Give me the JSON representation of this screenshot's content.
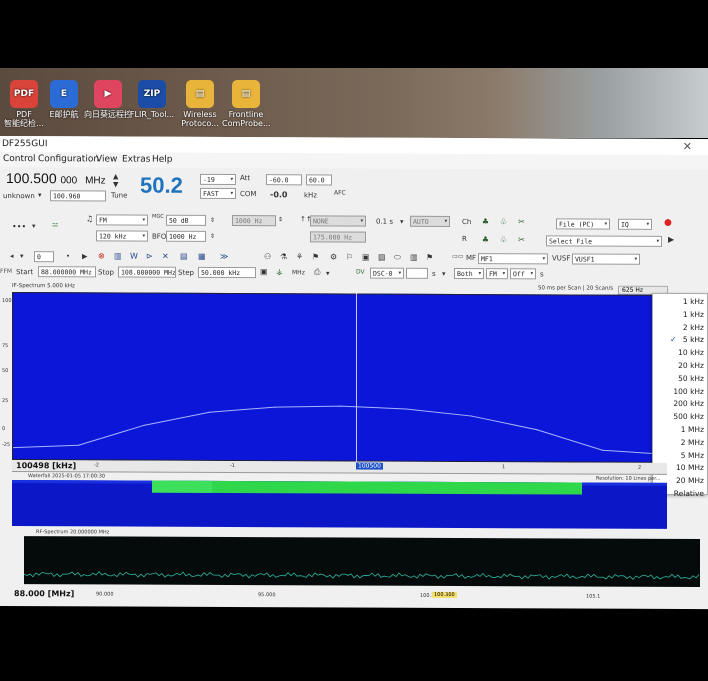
{
  "desktop": {
    "icons": [
      {
        "label": "PDF",
        "sub": "智能纪检…",
        "color": "#d9433a",
        "glyph": "PDF"
      },
      {
        "label": "E邮护航",
        "sub": "",
        "color": "#2b6bd6",
        "glyph": "E"
      },
      {
        "label": "向日葵远程控",
        "sub": "",
        "color": "#e0455f",
        "glyph": "▶"
      },
      {
        "label": "FLIR_Tool...",
        "sub": "",
        "color": "#1b4da8",
        "glyph": "ZIP"
      },
      {
        "label": "Wireless",
        "sub": "Protoco...",
        "color": "#e8b53a",
        "glyph": "▤"
      },
      {
        "label": "Frontline",
        "sub": "ComProbe...",
        "color": "#e8b53a",
        "glyph": "▤"
      }
    ]
  },
  "window": {
    "title": "DF255GUI",
    "close": "✕",
    "menu": [
      "Control",
      "Configuration",
      "View",
      "Extras",
      "Help"
    ]
  },
  "control": {
    "freq_main": "100.500",
    "freq_small": "000",
    "freq_unit": "MHz",
    "tune_label": "Tune",
    "unknown_label": "unknown",
    "step_value": "100.960",
    "level": "50.2",
    "att_value": "-19",
    "att_label": "Att",
    "fast_value": "FAST",
    "com_label": "COM",
    "offset_a": "-60.0",
    "offset_b": "60.0",
    "offset_c": "-0.0",
    "khz_label": "kHz",
    "afc_label": "AFC"
  },
  "row2": {
    "demod": "FM",
    "mgc_label": "MGC",
    "mgc_value": "50 dB",
    "bw_value": "1000 Hz",
    "ifbw_value": "120 kHz",
    "bfo_label": "BFO",
    "bfo_value": "1000 Hz",
    "noise_value": "NONE",
    "noise2_value": "175.000 Hz",
    "time_value": "0.1 s",
    "auto_value": "AUTO",
    "file_value": "File (PC)",
    "iq_value": "IQ",
    "select_file": "Select File",
    "ch_label": "Ch",
    "r_label": "R"
  },
  "row3": {
    "zero_value": "0",
    "start_label": "Start",
    "start_value": "88.000000 MHz",
    "stop_label": "Stop",
    "stop_value": "108.000000 MHz",
    "step_label": "Step",
    "step_value": "50.000 kHz",
    "mhz_label": "MHz",
    "dsc_value": "DSC-0",
    "s_label": "s",
    "both_value": "Both",
    "fm_value": "FM",
    "off_value": "Off",
    "mf_label": "MF",
    "mf_value": "MF1",
    "vusf_label": "VUSF",
    "vusf_value": "VUSF1"
  },
  "spectrum": {
    "title": "IF-Spectrum 5.000 kHz",
    "scan_info": "50 ms per Scan | 20 Scan/s",
    "res_button": "625 Hz",
    "ticks": [
      "100",
      "75",
      "50",
      "25",
      "0",
      "-25"
    ],
    "x_left": "100498 [kHz]",
    "x_center": "100500",
    "x_ticks": [
      "-2",
      "-1",
      "1",
      "2"
    ]
  },
  "resolution_menu": {
    "items": [
      "1 kHz",
      "1 kHz",
      "2 kHz",
      "5 kHz",
      "10 kHz",
      "20 kHz",
      "50 kHz",
      "100 kHz",
      "200 kHz",
      "500 kHz",
      "1 MHz",
      "2 MHz",
      "5 MHz",
      "10 MHz",
      "20 MHz",
      "Relative"
    ],
    "selected_index": 3,
    "check": "✓"
  },
  "waterfall": {
    "title": "Waterfall 2025-01-05 17:00:30",
    "resolution": "Resolution: 10 Lines per..."
  },
  "ifspectrum": {
    "title": "RF-Spectrum 20.000000 MHz",
    "x_left": "88.000 [MHz]",
    "x_ticks": [
      "90.000",
      "95.000",
      "100.1",
      "105.1"
    ],
    "x_highlight": "100.300"
  },
  "chart_data": {
    "type": "line",
    "x": [
      -2.5,
      -2.0,
      -1.5,
      -1.0,
      -0.5,
      0.0,
      0.5,
      1.0,
      1.5,
      2.0,
      2.5
    ],
    "series": [
      {
        "values": [
          -15,
          -13,
          2,
          12,
          16,
          17,
          15,
          10,
          0,
          -15,
          -18
        ]
      }
    ],
    "ylim": [
      -25,
      100
    ],
    "xlim": [
      -2.5,
      2.5
    ],
    "x_ticks": [
      "-2",
      "-1",
      "1",
      "2"
    ],
    "grid": false
  }
}
